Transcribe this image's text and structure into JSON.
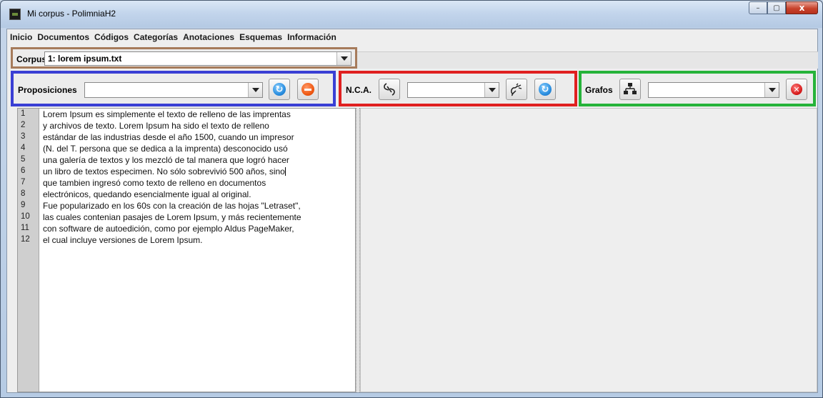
{
  "window": {
    "title": "Mi corpus - PolimniaH2",
    "minimize": "–",
    "maximize": "▢",
    "close": "x"
  },
  "menu": [
    "Inicio",
    "Documentos",
    "Códigos",
    "Categorías",
    "Anotaciones",
    "Esquemas",
    "Información"
  ],
  "corpus": {
    "label": "Corpus",
    "selected": "1: lorem ipsum.txt"
  },
  "proposiciones": {
    "label": "Proposiciones",
    "selected": ""
  },
  "nca": {
    "label": "N.C.A.",
    "selected": ""
  },
  "grafos": {
    "label": "Grafos",
    "selected": ""
  },
  "editor": {
    "lines": [
      {
        "n": "1",
        "text": "Lorem Ipsum es simplemente el texto de relleno de las imprentas"
      },
      {
        "n": "2",
        "text": "y archivos de texto. Lorem Ipsum ha sido el texto de relleno"
      },
      {
        "n": "3",
        "text": "estándar de las industrias desde el año 1500, cuando un impresor"
      },
      {
        "n": "4",
        "text": "(N. del T. persona que se dedica a la imprenta) desconocido usó"
      },
      {
        "n": "5",
        "text": "una galería de textos y los mezcló de tal manera que logró hacer"
      },
      {
        "n": "6",
        "text": "un libro de textos especimen. No sólo sobrevivió 500 años, sino"
      },
      {
        "n": "7",
        "text": "que tambien ingresó como texto de relleno en documentos"
      },
      {
        "n": "8",
        "text": "electrónicos, quedando esencialmente igual al original."
      },
      {
        "n": "9",
        "text": "Fue popularizado en los 60s con la creación de las hojas \"Letraset\","
      },
      {
        "n": "10",
        "text": "las cuales contenian pasajes de Lorem Ipsum, y más recientemente"
      },
      {
        "n": "11",
        "text": "con software de autoedición, como por ejemplo Aldus PageMaker,"
      },
      {
        "n": "12",
        "text": "el cual incluye versiones de Lorem Ipsum."
      }
    ]
  },
  "colors": {
    "corpus_border": "#a67b5b",
    "proposiciones_border": "#3a3fd4",
    "nca_border": "#e02020",
    "grafos_border": "#26b33a"
  },
  "icons": {
    "proposiciones_refresh": "refresh-icon",
    "proposiciones_stop": "stop-icon",
    "nca_link": "link-icon",
    "nca_unlink": "unlink-icon",
    "nca_refresh": "refresh-icon",
    "grafos_graph": "network-graph-icon",
    "grafos_cancel": "cancel-icon"
  }
}
